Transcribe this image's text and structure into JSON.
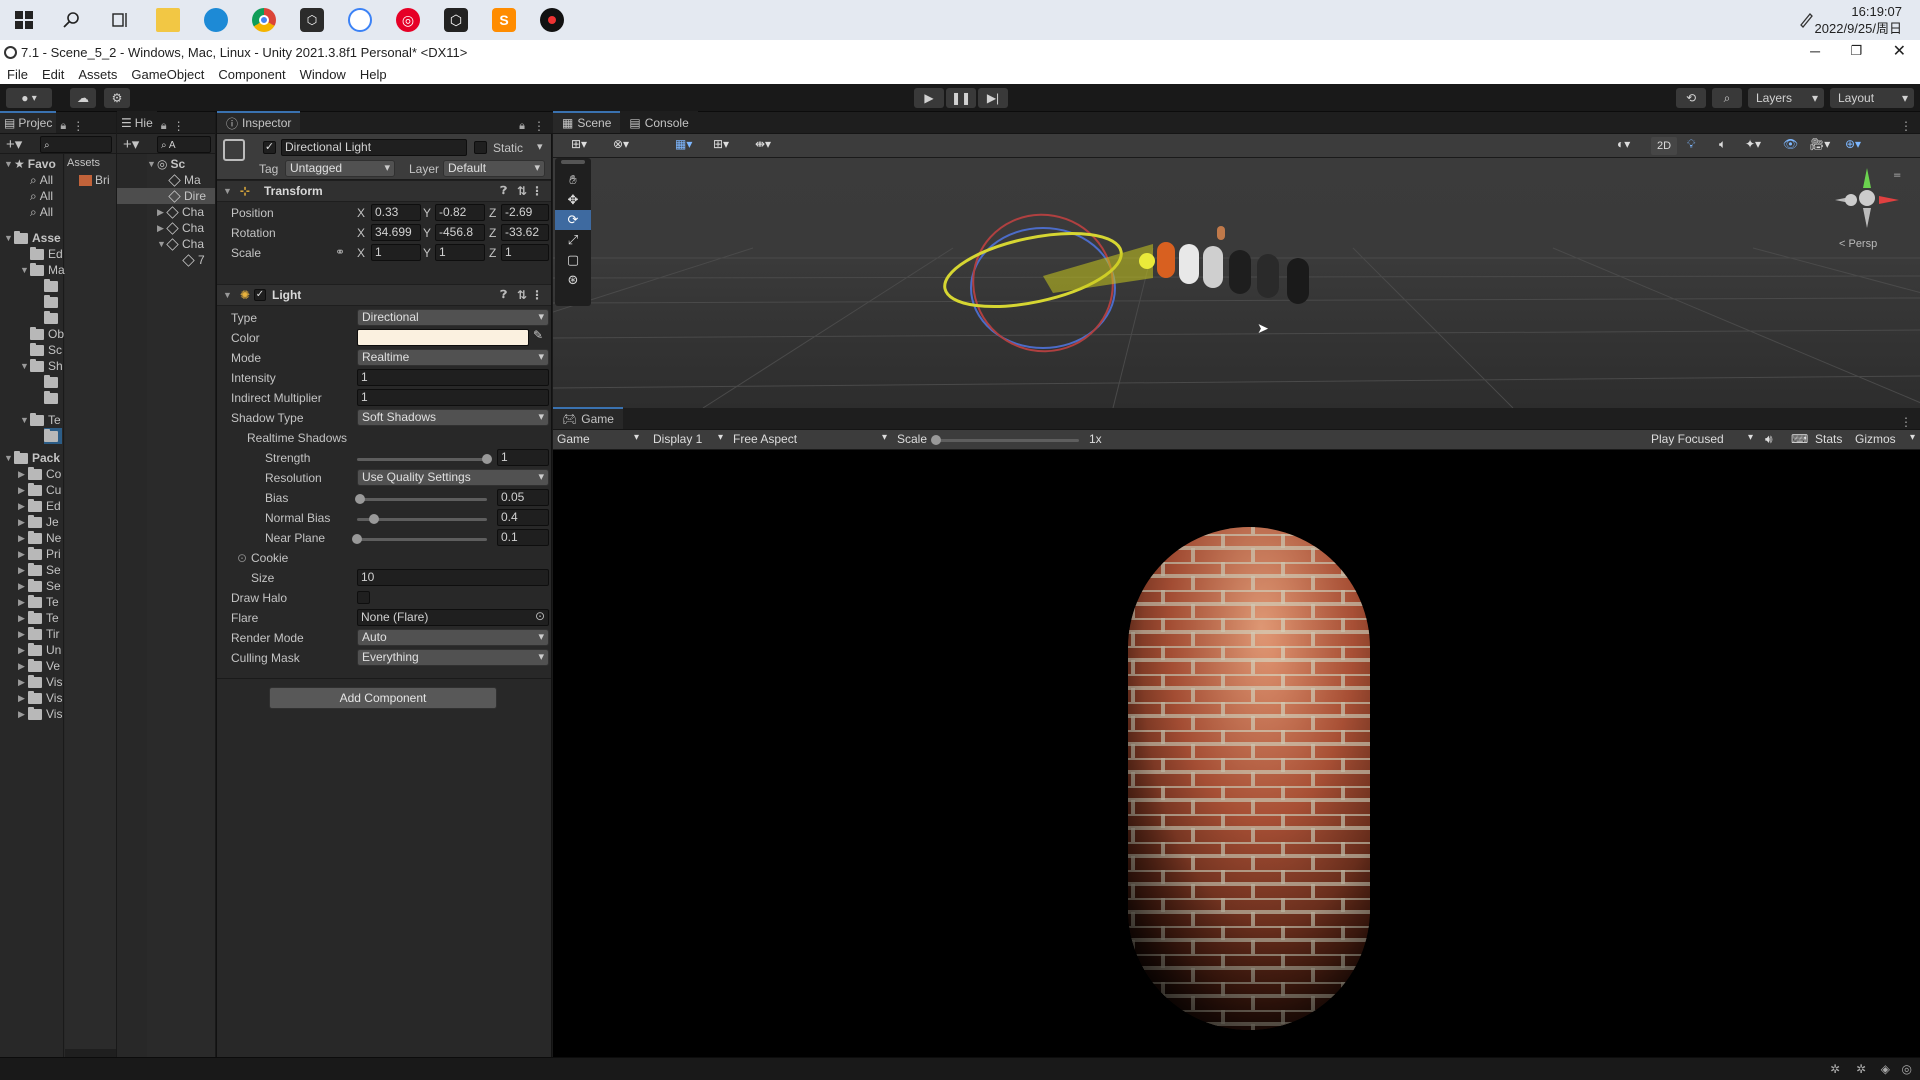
{
  "taskbar": {
    "icons": [
      "windows-start-icon",
      "search-icon",
      "task-view-icon",
      "file-explorer-icon",
      "edge-browser-icon",
      "chrome-browser-icon",
      "unity-hub-icon",
      "app-icon",
      "netease-music-icon",
      "unity-icon",
      "sublime-text-icon",
      "app-dark-icon"
    ],
    "time": "16:19:07",
    "date": "2022/9/25/周日"
  },
  "window": {
    "title": "7.1 - Scene_5_2 - Windows, Mac, Linux - Unity 2021.3.8f1 Personal* <DX11>"
  },
  "menu": [
    "File",
    "Edit",
    "Assets",
    "GameObject",
    "Component",
    "Window",
    "Help"
  ],
  "toolbar": {
    "layers": "Layers",
    "layout": "Layout"
  },
  "project": {
    "tab": "Projec",
    "favorites_label": "Favo",
    "assets_crumb": "Assets",
    "favorites": [
      "All",
      "All",
      "All"
    ],
    "assets_label": "Asse",
    "asset_folders": [
      "Ed",
      "Ma",
      "",
      "",
      "",
      "Ob",
      "Sc",
      "Sh",
      "",
      "",
      "Te",
      ""
    ],
    "packages_label": "Pack",
    "package_folders": [
      "Co",
      "Cu",
      "Ed",
      "Je",
      "Ne",
      "Pri",
      "Se",
      "Se",
      "Te",
      "Te",
      "Tir",
      "Un",
      "Ve",
      "Vis",
      "Vis",
      "Vis"
    ],
    "asset_item": "Bri"
  },
  "hierarchy": {
    "tab": "Hie",
    "items": [
      "Sc",
      "Ma",
      "Dire",
      "Cha",
      "Cha",
      "Cha",
      "7"
    ]
  },
  "inspector": {
    "tab": "Inspector",
    "object_name": "Directional Light",
    "static_label": "Static",
    "tag_label": "Tag",
    "tag_value": "Untagged",
    "layer_label": "Layer",
    "layer_value": "Default",
    "transform": {
      "title": "Transform",
      "position_label": "Position",
      "rotation_label": "Rotation",
      "scale_label": "Scale",
      "position": {
        "x": "0.33",
        "y": "-0.82",
        "z": "-2.69"
      },
      "rotation": {
        "x": "34.699",
        "y": "-456.8",
        "z": "-33.62"
      },
      "scale": {
        "x": "1",
        "y": "1",
        "z": "1"
      },
      "x": "X",
      "y": "Y",
      "z": "Z"
    },
    "light": {
      "title": "Light",
      "type_label": "Type",
      "type_value": "Directional",
      "color_label": "Color",
      "color_value": "#fbf1e0",
      "mode_label": "Mode",
      "mode_value": "Realtime",
      "intensity_label": "Intensity",
      "intensity_value": "1",
      "indirect_label": "Indirect Multiplier",
      "indirect_value": "1",
      "shadow_type_label": "Shadow Type",
      "shadow_type_value": "Soft Shadows",
      "realtime_shadows_label": "Realtime Shadows",
      "strength_label": "Strength",
      "strength_value": "1",
      "strength_fraction": 1.0,
      "resolution_label": "Resolution",
      "resolution_value": "Use Quality Settings",
      "bias_label": "Bias",
      "bias_value": "0.05",
      "bias_fraction": 0.025,
      "normal_bias_label": "Normal Bias",
      "normal_bias_value": "0.4",
      "normal_bias_fraction": 0.13,
      "near_plane_label": "Near Plane",
      "near_plane_value": "0.1",
      "near_plane_fraction": 0.0,
      "cookie_label": "Cookie",
      "size_label": "Size",
      "size_value": "10",
      "draw_halo_label": "Draw Halo",
      "flare_label": "Flare",
      "flare_value": "None (Flare)",
      "render_mode_label": "Render Mode",
      "render_mode_value": "Auto",
      "culling_mask_label": "Culling Mask",
      "culling_mask_value": "Everything"
    },
    "add_component": "Add Component"
  },
  "scene": {
    "tab_scene": "Scene",
    "tab_console": "Console",
    "toggle_2d": "2D",
    "persp": "< Persp"
  },
  "game": {
    "tab": "Game",
    "view_dropdown": "Game",
    "display": "Display 1",
    "aspect": "Free Aspect",
    "scale_label": "Scale",
    "scale_value": "1x",
    "play_mode": "Play Focused",
    "stats": "Stats",
    "gizmos": "Gizmos"
  }
}
